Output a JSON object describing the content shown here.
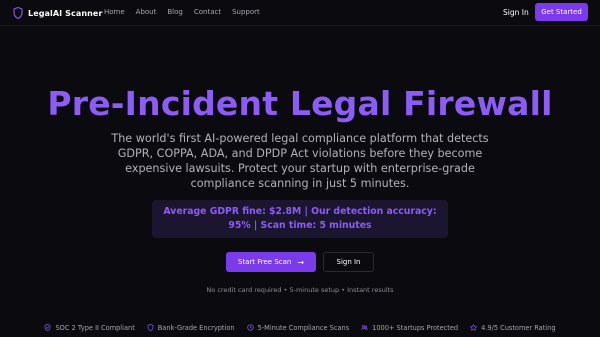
{
  "nav": {
    "brand": "LegalAI Scanner",
    "brand_icon": "shield-icon",
    "links": [
      "Home",
      "About",
      "Blog",
      "Contact",
      "Support"
    ],
    "signin": "Sign In",
    "cta": "Get Started"
  },
  "hero": {
    "title": "Pre-Incident Legal Firewall",
    "subtitle": "The world's first AI-powered legal compliance platform that detects GDPR, COPPA, ADA, and DPDP Act violations before they become expensive lawsuits. Protect your startup with enterprise-grade compliance scanning in just 5 minutes.",
    "stats": "Average GDPR fine: $2.8M | Our detection accuracy: 95% | Scan time: 5 minutes",
    "primary_button": "Start Free Scan",
    "primary_icon": "arrow-right-icon",
    "secondary_button": "Sign In",
    "fine_print": "No credit card required • 5-minute setup • Instant results"
  },
  "badges": [
    {
      "icon": "shield-check-icon",
      "label": "SOC 2 Type II Compliant"
    },
    {
      "icon": "shield-icon",
      "label": "Bank-Grade Encryption"
    },
    {
      "icon": "clock-icon",
      "label": "5-Minute Compliance Scans"
    },
    {
      "icon": "users-icon",
      "label": "1000+ Startups Protected"
    },
    {
      "icon": "star-icon",
      "label": "4.9/5 Customer Rating"
    }
  ],
  "colors": {
    "background": "#0b0a0f",
    "accent": "#7c3aed",
    "accent_text": "#8b5cf6",
    "stat_box": "#1b1530"
  }
}
